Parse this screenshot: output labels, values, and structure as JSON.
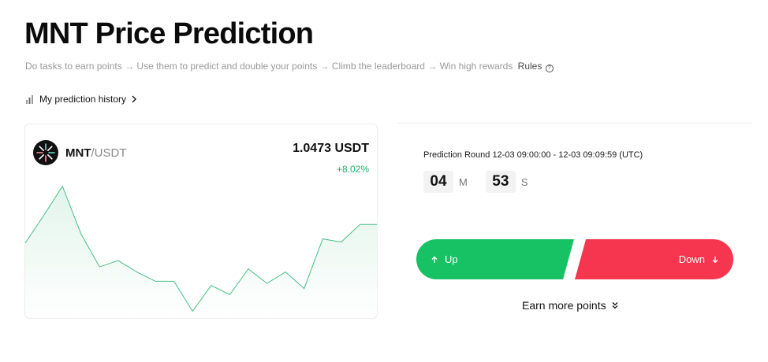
{
  "header": {
    "title": "MNT Price Prediction",
    "subtitle": "Do tasks to earn points → Use them to predict and double your points → Climb the leaderboard → Win high rewards",
    "rules_label": "Rules",
    "rules_icon": "question-circle-icon"
  },
  "history": {
    "label": "My prediction history",
    "icon": "bar-chart-icon",
    "chevron": "chevron-right-icon"
  },
  "market": {
    "base": "MNT",
    "separator": "/",
    "quote": "USDT",
    "price": "1.0473 USDT",
    "change": "+8.02%",
    "change_color": "#20b26c"
  },
  "chart_data": {
    "type": "area",
    "series": [
      {
        "values": [
          0.985,
          1.012,
          1.04,
          0.994,
          0.962,
          0.968,
          0.957,
          0.948,
          0.948,
          0.919,
          0.944,
          0.935,
          0.96,
          0.946,
          0.957,
          0.941,
          0.989,
          0.986,
          1.003,
          1.003
        ]
      }
    ],
    "line_color": "#48be85",
    "grid": false
  },
  "prediction": {
    "round_label": "Prediction Round 12-03 09:00:00 - 12-03 09:09:59 (UTC)",
    "minutes": "04",
    "minutes_unit": "M",
    "seconds": "53",
    "seconds_unit": "S",
    "up_label": "Up",
    "down_label": "Down",
    "up_color": "#16c264",
    "down_color": "#f5364e"
  },
  "footer": {
    "earn_label": "Earn more points",
    "earn_icon": "double-chevron-down-icon"
  }
}
